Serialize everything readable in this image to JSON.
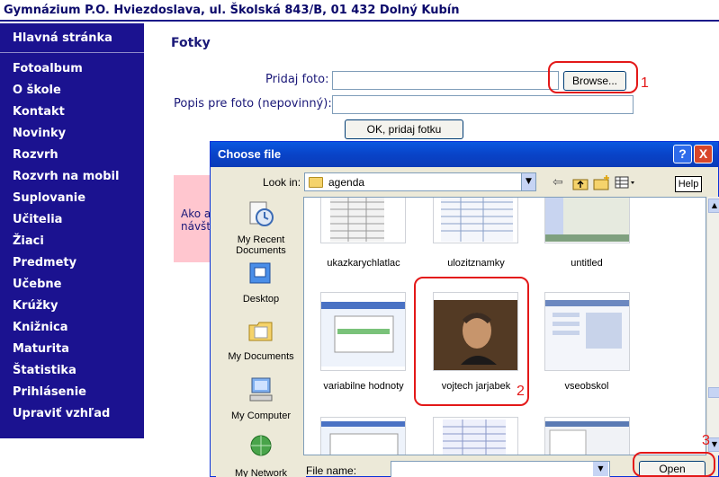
{
  "header": {
    "title": "Gymnázium P.O. Hviezdoslava, ul. Školská 843/B, 01 432 Dolný Kubín"
  },
  "sidebar": {
    "items": [
      {
        "label": "Hlavná stránka"
      },
      {
        "label": "Fotoalbum"
      },
      {
        "label": "O škole"
      },
      {
        "label": "Kontakt"
      },
      {
        "label": "Novinky"
      },
      {
        "label": "Rozvrh"
      },
      {
        "label": "Rozvrh na mobil"
      },
      {
        "label": "Suplovanie"
      },
      {
        "label": "Učitelia"
      },
      {
        "label": "Žiaci"
      },
      {
        "label": "Predmety"
      },
      {
        "label": "Učebne"
      },
      {
        "label": "Krúžky"
      },
      {
        "label": "Knižnica"
      },
      {
        "label": "Maturita"
      },
      {
        "label": "Štatistika"
      },
      {
        "label": "Prihlásenie"
      },
      {
        "label": "Upraviť vzhľad"
      }
    ]
  },
  "main": {
    "title": "Fotky",
    "add_photo_label": "Pridaj foto:",
    "browse_label": "Browse...",
    "description_label": "Popis pre foto (nepovinný):",
    "submit_label": "OK, pridaj fotku",
    "notice_line1": "Ako a",
    "notice_line2": "návšt"
  },
  "annotations": [
    "1",
    "2",
    "3"
  ],
  "dialog": {
    "title": "Choose file",
    "help_glyph": "?",
    "close_glyph": "X",
    "look_in_label": "Look in:",
    "look_in_value": "agenda",
    "help_button": "Help",
    "places": [
      {
        "label": "My Recent Documents",
        "icon": "recent-documents-icon"
      },
      {
        "label": "Desktop",
        "icon": "desktop-icon"
      },
      {
        "label": "My Documents",
        "icon": "my-documents-icon"
      },
      {
        "label": "My Computer",
        "icon": "my-computer-icon"
      },
      {
        "label": "My Network",
        "icon": "my-network-icon"
      }
    ],
    "files": [
      {
        "name": "ukazkarychlatlac"
      },
      {
        "name": "ulozitznamky"
      },
      {
        "name": "untitled"
      },
      {
        "name": "variabilne hodnoty"
      },
      {
        "name": "vojtech jarjabek"
      },
      {
        "name": "vseobskol"
      }
    ],
    "file_name_label": "File name:",
    "file_name_value": "",
    "open_label": "Open"
  },
  "colors": {
    "sidebar_bg": "#1b1290",
    "accent_text": "#1a1878",
    "annotation_red": "#e31818",
    "notice_bg": "#ffc6cf",
    "titlebar_blue": "#0a58e0"
  }
}
